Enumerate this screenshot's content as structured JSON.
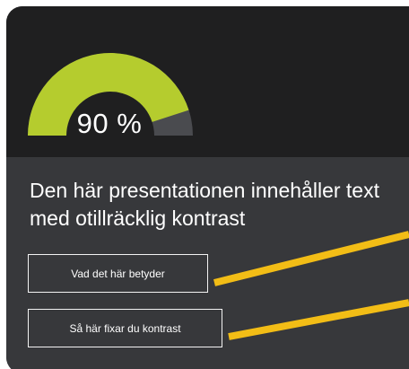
{
  "gauge": {
    "value_percent": 90,
    "value_text": "90 %",
    "colors": {
      "filled": "#b5cc2e",
      "track": "#4a4b4f"
    }
  },
  "message": {
    "text": "Den här presentationen innehåller text med otillräcklig kontrast"
  },
  "actions": {
    "what_it_means_label": "Vad det här betyder",
    "how_to_fix_label": "Så här fixar du kontrast"
  },
  "theme": {
    "card_top": "#1f1f20",
    "card_bottom": "#37383b",
    "accent_line": "#f2bd16"
  }
}
